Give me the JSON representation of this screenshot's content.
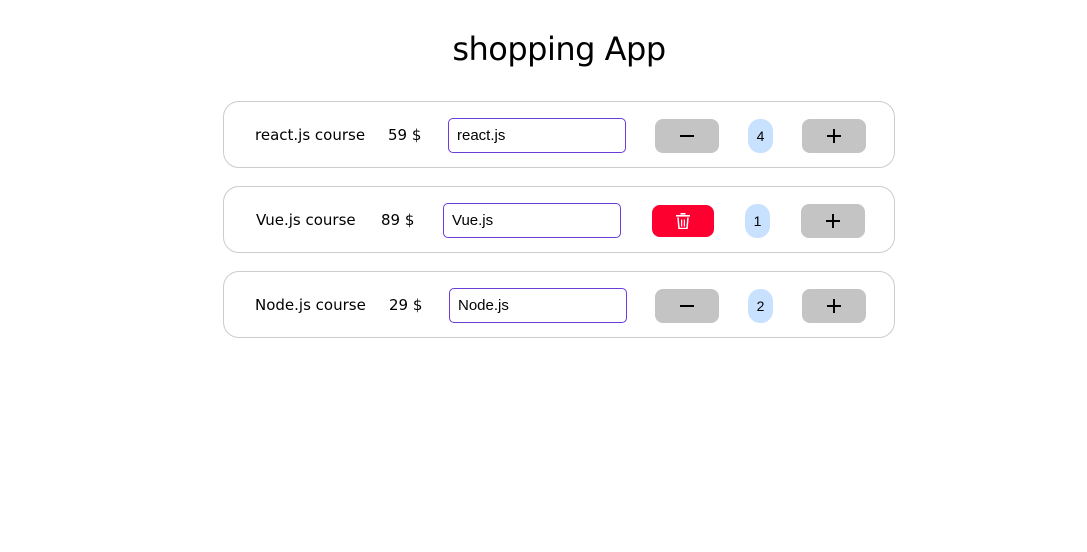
{
  "app": {
    "title": "shopping App"
  },
  "products": [
    {
      "name": "react.js course",
      "price": "59 $",
      "input_value": "react.js",
      "quantity": "4",
      "decrement_action": "minus",
      "increment_icon": "plus-icon",
      "decrement_icon": "minus-icon"
    },
    {
      "name": "Vue.js course",
      "price": "89 $",
      "input_value": "Vue.js",
      "quantity": "1",
      "decrement_action": "delete",
      "increment_icon": "plus-icon",
      "decrement_icon": "trash-icon"
    },
    {
      "name": "Node.js course",
      "price": "29 $",
      "input_value": "Node.js",
      "quantity": "2",
      "decrement_action": "minus",
      "increment_icon": "plus-icon",
      "decrement_icon": "minus-icon"
    }
  ],
  "colors": {
    "card_border": "#cccccc",
    "input_border": "#6a3ddb",
    "button_gray": "#c4c4c4",
    "delete_red": "#fd002f",
    "quantity_bg": "#c7e1fe"
  }
}
